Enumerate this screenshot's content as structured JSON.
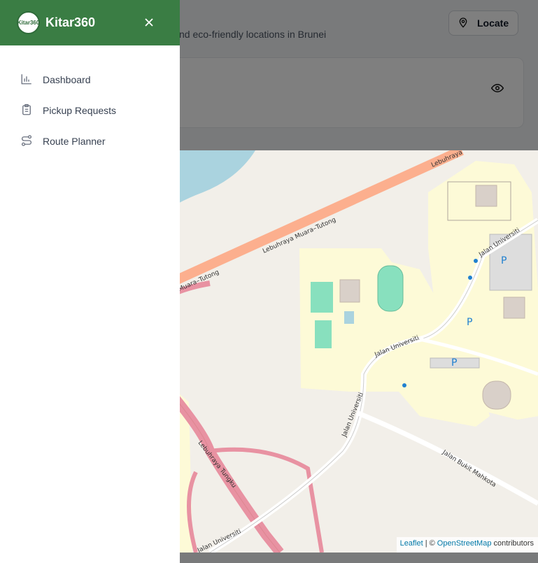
{
  "app": {
    "brand": "Kitar360",
    "logo_text": "Kitar360"
  },
  "background": {
    "subtitle": "nd eco-friendly locations in Brunei",
    "locate_label": "Locate"
  },
  "sidebar": {
    "items": [
      {
        "label": "Dashboard",
        "icon": "chart-icon"
      },
      {
        "label": "Pickup Requests",
        "icon": "clipboard-icon"
      },
      {
        "label": "Route Planner",
        "icon": "route-icon"
      }
    ]
  },
  "map": {
    "zoom_in": "+",
    "zoom_out": "−",
    "attribution": {
      "leaflet": "Leaflet",
      "sep": "| ©",
      "osm": "OpenStreetMap",
      "suffix": "contributors"
    },
    "road_labels": {
      "muara_tutong": "Lebuhraya Muara–Tutong",
      "muara_tutong_left": "a Muara–Tutong",
      "muara_tutong_top": "Lebuhraya",
      "tungku": "Lebuhraya Tungku",
      "tungku_2": "Lebuhraya Tungku",
      "tungku_3": "Lebuhraya Tungku",
      "tungku_4": "Lebuhraya Tungku",
      "jalan_universiti": "Jalan Universiti",
      "jalan_universiti_2": "Jalan Universiti",
      "jalan_universiti_3": "Jalan Universiti",
      "jalan_universiti_4": "Jalan Universiti",
      "bukit_mahkota": "Jalan Bukit Mahkota",
      "parking": "P"
    }
  }
}
